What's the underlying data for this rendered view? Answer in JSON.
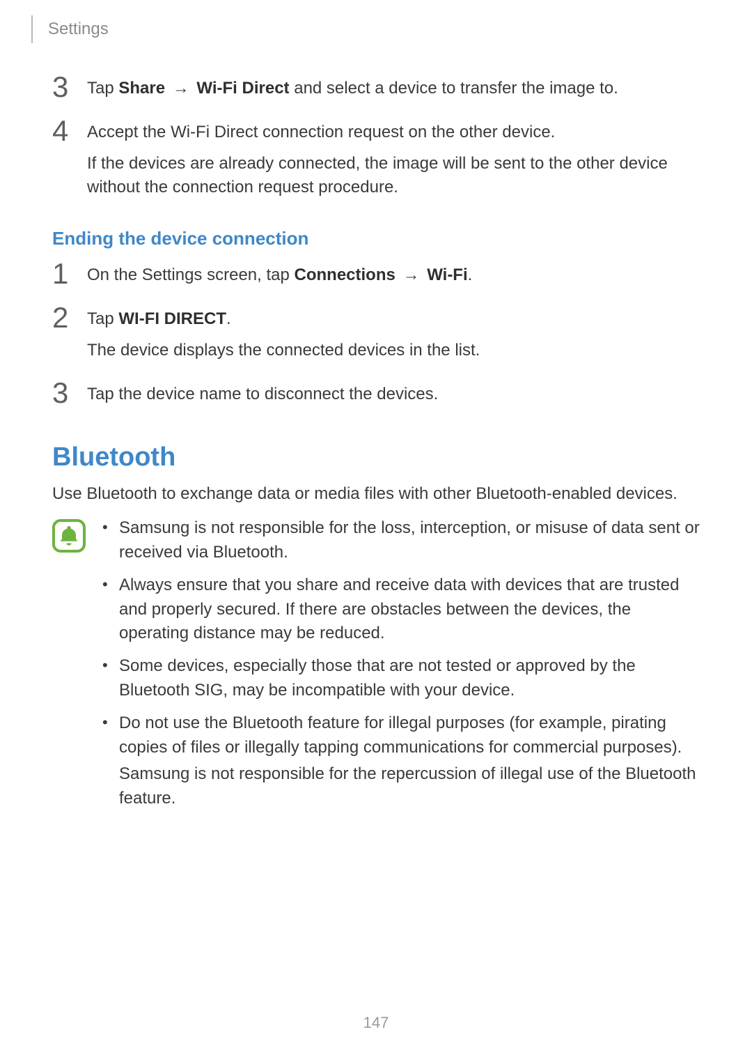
{
  "header": {
    "title": "Settings"
  },
  "list1": {
    "step3": {
      "num": "3",
      "l1a": "Tap ",
      "l1b": "Share",
      "l1c": " → ",
      "l1d": "Wi-Fi Direct",
      "l1e": " and select a device to transfer the image to."
    },
    "step4": {
      "num": "4",
      "l1": "Accept the Wi-Fi Direct connection request on the other device.",
      "l2": "If the devices are already connected, the image will be sent to the other device without the connection request procedure."
    }
  },
  "sub1": "Ending the device connection",
  "list2": {
    "step1": {
      "num": "1",
      "l1a": "On the Settings screen, tap ",
      "l1b": "Connections",
      "l1c": " → ",
      "l1d": "Wi-Fi",
      "l1e": "."
    },
    "step2": {
      "num": "2",
      "l1a": "Tap ",
      "l1b": "WI-FI DIRECT",
      "l1c": ".",
      "l2": "The device displays the connected devices in the list."
    },
    "step3": {
      "num": "3",
      "l1": "Tap the device name to disconnect the devices."
    }
  },
  "bt": {
    "heading": "Bluetooth",
    "intro": "Use Bluetooth to exchange data or media files with other Bluetooth-enabled devices.",
    "bul1": "Samsung is not responsible for the loss, interception, or misuse of data sent or received via Bluetooth.",
    "bul2": "Always ensure that you share and receive data with devices that are trusted and properly secured. If there are obstacles between the devices, the operating distance may be reduced.",
    "bul3": "Some devices, especially those that are not tested or approved by the Bluetooth SIG, may be incompatible with your device.",
    "bul4a": "Do not use the Bluetooth feature for illegal purposes (for example, pirating copies of files or illegally tapping communications for commercial purposes).",
    "bul4b": "Samsung is not responsible for the repercussion of illegal use of the Bluetooth feature."
  },
  "page_number": "147"
}
